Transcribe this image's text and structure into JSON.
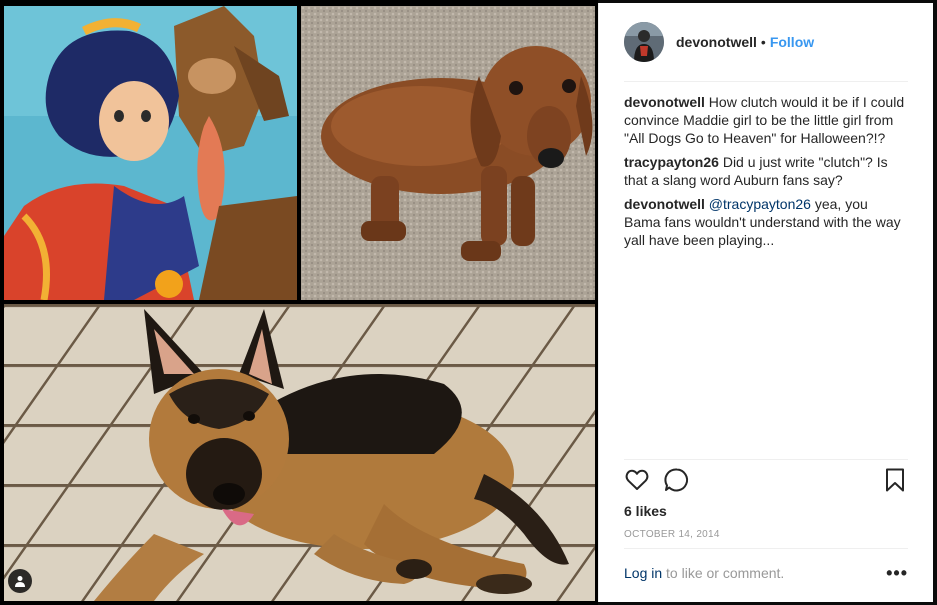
{
  "post": {
    "username": "devonotwell",
    "separator": "•",
    "follow_label": "Follow",
    "likes": "6 likes",
    "date": "OCTOBER 14, 2014"
  },
  "comments": [
    {
      "user": "devonotwell",
      "text": "How clutch would it be if I could convince Maddie girl to be the little girl from \"All Dogs Go to Heaven\" for Halloween?!?"
    },
    {
      "user": "tracypayton26",
      "text": "Did u just write \"clutch\"? Is that a slang word Auburn fans say?"
    },
    {
      "user": "devonotwell",
      "mention": "@tracypayton26",
      "text": "yea, you Bama fans wouldn't understand with the way yall have been playing..."
    }
  ],
  "footer": {
    "login_link": "Log in",
    "login_text": "to like or comment.",
    "more_label": "•••"
  },
  "icons": {
    "like": "heart-icon",
    "comment": "comment-bubble-icon",
    "save": "bookmark-icon",
    "tagged": "user-tag-icon"
  },
  "colors": {
    "link_blue": "#3897f0",
    "text_dark": "#262626",
    "muted": "#999999",
    "mention": "#003569"
  }
}
